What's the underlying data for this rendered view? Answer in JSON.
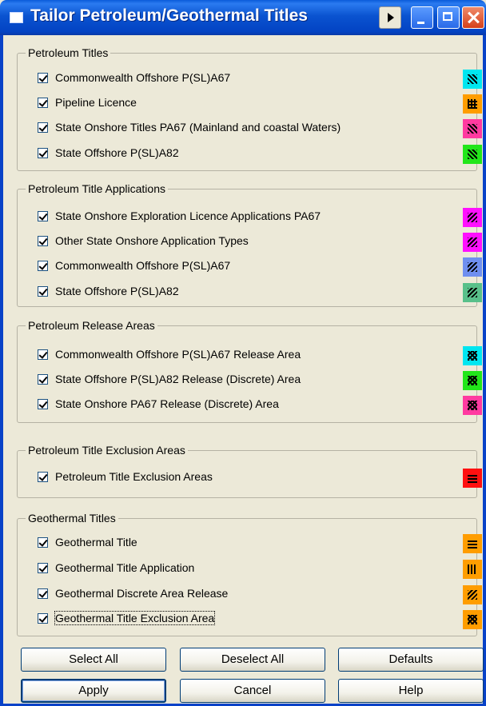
{
  "window": {
    "title": "Tailor Petroleum/Geothermal Titles"
  },
  "groups": [
    {
      "title": "Petroleum Titles",
      "items": [
        {
          "label": "Commonwealth Offshore P(SL)A67",
          "checked": true,
          "color": "#00e6f0",
          "pattern": "diag"
        },
        {
          "label": "Pipeline Licence",
          "checked": true,
          "color": "#ff9d00",
          "pattern": "grid"
        },
        {
          "label": "State Onshore Titles PA67 (Mainland and coastal Waters)",
          "checked": true,
          "color": "#ff3aa0",
          "pattern": "diag"
        },
        {
          "label": "State Offshore P(SL)A82",
          "checked": true,
          "color": "#22e61a",
          "pattern": "diag"
        }
      ]
    },
    {
      "title": "Petroleum Title Applications",
      "items": [
        {
          "label": "State Onshore Exploration Licence Applications PA67",
          "checked": true,
          "color": "#ff10ff",
          "pattern": "diag2"
        },
        {
          "label": "Other State Onshore Application Types",
          "checked": true,
          "color": "#ff10ff",
          "pattern": "diag2"
        },
        {
          "label": "Commonwealth Offshore P(SL)A67",
          "checked": true,
          "color": "#6f8ff0",
          "pattern": "diag2"
        },
        {
          "label": "State Offshore P(SL)A82",
          "checked": true,
          "color": "#58c08a",
          "pattern": "diag2"
        }
      ]
    },
    {
      "title": "Petroleum Release Areas",
      "items": [
        {
          "label": "Commonwealth Offshore P(SL)A67 Release Area",
          "checked": true,
          "color": "#00e6f0",
          "pattern": "cross"
        },
        {
          "label": "State Offshore P(SL)A82 Release (Discrete) Area",
          "checked": true,
          "color": "#22e61a",
          "pattern": "cross"
        },
        {
          "label": "State Onshore PA67 Release (Discrete) Area",
          "checked": true,
          "color": "#ff3aa0",
          "pattern": "cross"
        }
      ]
    },
    {
      "title": "Petroleum Title Exclusion Areas",
      "items": [
        {
          "label": "Petroleum Title Exclusion Areas",
          "checked": true,
          "color": "#ff1010",
          "pattern": "hlines"
        }
      ]
    },
    {
      "title": "Geothermal Titles",
      "items": [
        {
          "label": "Geothermal Title",
          "checked": true,
          "color": "#ff9d00",
          "pattern": "hlines"
        },
        {
          "label": "Geothermal Title Application",
          "checked": true,
          "color": "#ff9d00",
          "pattern": "vlines"
        },
        {
          "label": "Geothermal Discrete Area Release",
          "checked": true,
          "color": "#ff9d00",
          "pattern": "diag2"
        },
        {
          "label": "Geothermal Title Exclusion Area",
          "checked": true,
          "color": "#ff9d00",
          "pattern": "cross",
          "focused": true
        }
      ]
    }
  ],
  "buttons": {
    "select_all": "Select All",
    "deselect_all": "Deselect All",
    "defaults": "Defaults",
    "apply": "Apply",
    "cancel": "Cancel",
    "help": "Help"
  }
}
